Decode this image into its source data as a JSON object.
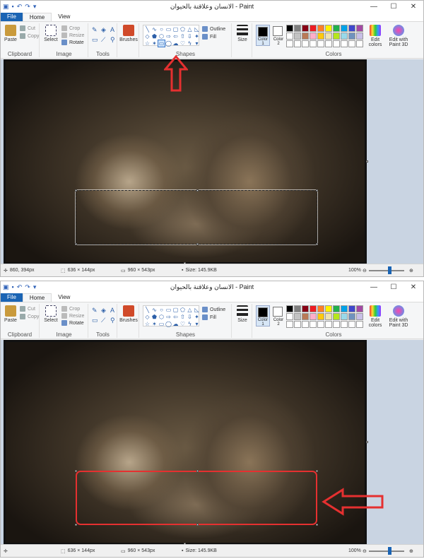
{
  "window": {
    "title": "الانسان وعلاقتة بالحيوان - Paint",
    "controls": [
      "—",
      "☐",
      "✕"
    ]
  },
  "tabs": [
    "File",
    "Home",
    "View"
  ],
  "ribbon": {
    "clipboard": {
      "label": "Clipboard",
      "paste": "Paste",
      "cut": "Cut",
      "copy": "Copy"
    },
    "image": {
      "label": "Image",
      "select": "Select",
      "crop": "Crop",
      "resize": "Resize",
      "rotate": "Rotate"
    },
    "tools": {
      "label": "Tools"
    },
    "brushes": {
      "label": "Brushes"
    },
    "shapes": {
      "label": "Shapes",
      "outline": "Outline",
      "fill": "Fill"
    },
    "size": {
      "label": "Size"
    },
    "colors": {
      "label": "Colors",
      "color1": "Color\n1",
      "color2": "Color\n2",
      "edit_colors": "Edit colors",
      "edit_paint3d": "Edit with Paint 3D",
      "palette_row1": [
        "#000000",
        "#7f7f7f",
        "#880015",
        "#ed1c24",
        "#ff7f27",
        "#fff200",
        "#22b14c",
        "#00a2e8",
        "#3f48cc",
        "#a349a4"
      ],
      "palette_row2": [
        "#ffffff",
        "#c3c3c3",
        "#b97a57",
        "#ffaec9",
        "#ffc90e",
        "#efe4b0",
        "#b5e61d",
        "#99d9ea",
        "#7092be",
        "#c8bfe7"
      ],
      "palette_row3": [
        "#ffffff",
        "#ffffff",
        "#ffffff",
        "#ffffff",
        "#ffffff",
        "#ffffff",
        "#ffffff",
        "#ffffff",
        "#ffffff",
        "#ffffff"
      ]
    }
  },
  "status_top": {
    "cursor": "860, 394px",
    "selection": "636 × 144px",
    "image_size": "960 × 543px",
    "file_size": "Size: 145.9KB",
    "zoom": "100%"
  },
  "status_bottom": {
    "cursor": "",
    "selection": "636 × 144px",
    "image_size": "960 × 543px",
    "file_size": "Size: 145.9KB",
    "zoom": "100%"
  },
  "colors_accent": {
    "file_tab": "#1a64b4",
    "annotation": "#e53030"
  }
}
